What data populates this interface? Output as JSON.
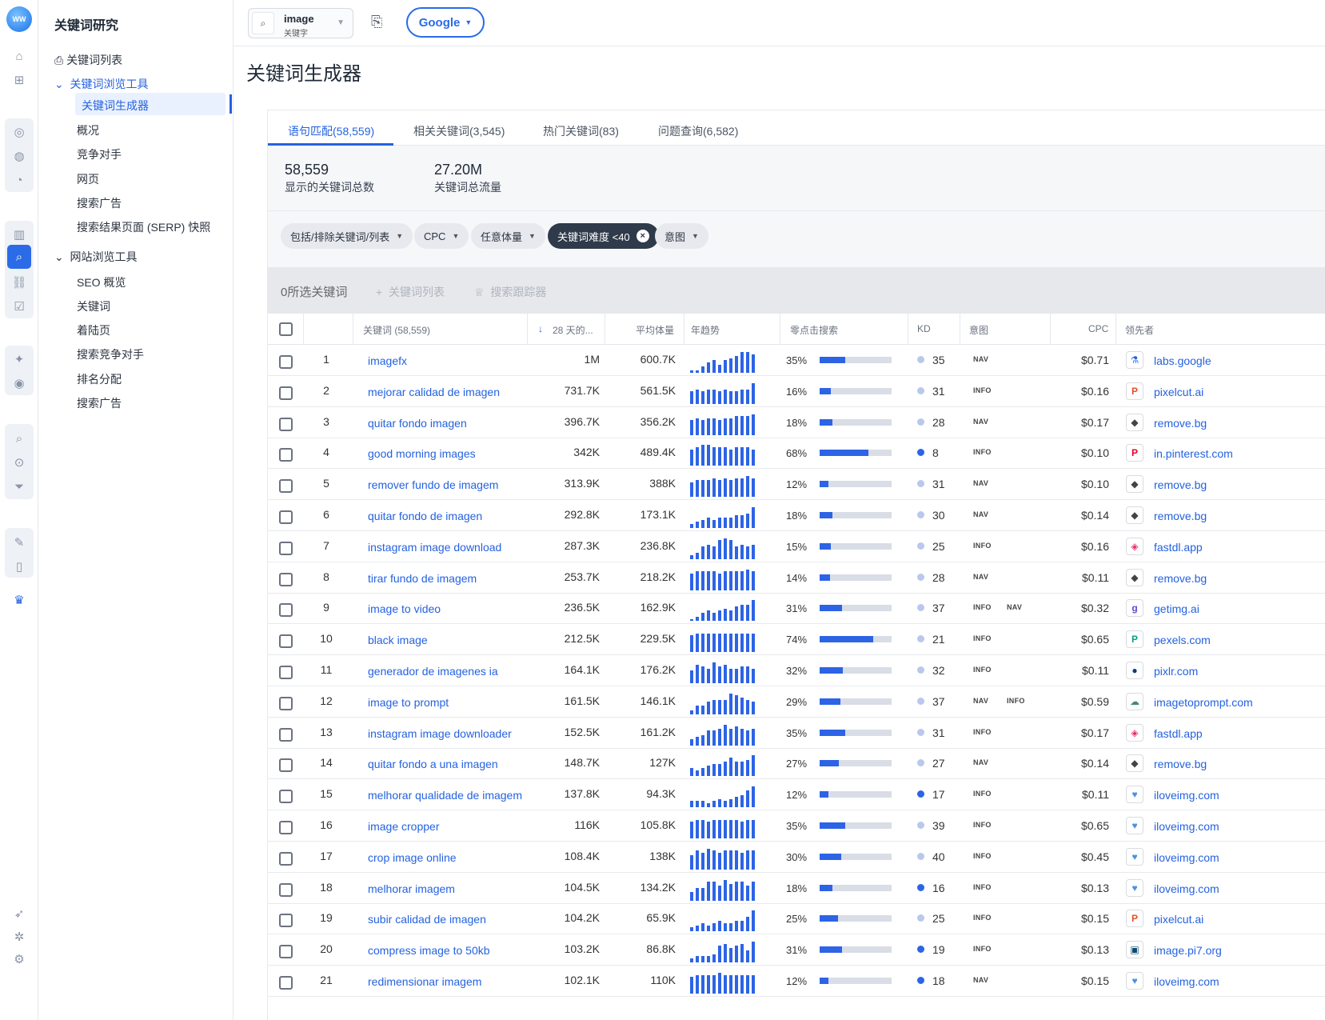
{
  "rail": {
    "logo": "WW",
    "icons": [
      "home-icon",
      "apps-icon",
      "globe-icon",
      "globe-2-icon",
      "pie-icon",
      "bar-chart-icon",
      "keyword-research-icon",
      "link-icon",
      "check-list-icon",
      "sparkle-icon",
      "eye-sparkle-icon",
      "search-zoom-icon",
      "search-target-icon",
      "filter-icon",
      "doc-check-icon",
      "phone-icon",
      "crown-icon",
      "rocket-icon",
      "puzzle-icon",
      "settings-icon"
    ]
  },
  "nav": {
    "title": "关键词研究",
    "keyword_list": "关键词列表",
    "explorer": "关键词浏览工具",
    "items1": [
      "关键词生成器",
      "概况",
      "竞争对手",
      "网页",
      "搜索广告",
      "搜索结果页面 (SERP) 快照"
    ],
    "site_explorer": "网站浏览工具",
    "items2": [
      "SEO 概览",
      "关键词",
      "着陆页",
      "搜索竞争对手",
      "排名分配",
      "搜索广告"
    ]
  },
  "top": {
    "search_value": "image",
    "search_sub": "关键字",
    "engine": "Google"
  },
  "page_title": "关键词生成器",
  "tabs": [
    "语句匹配(58,559)",
    "相关关键词(3,545)",
    "热门关键词(83)",
    "问题查询(6,582)"
  ],
  "stats": [
    {
      "value": "58,559",
      "label": "显示的关键词总数"
    },
    {
      "value": "27.20M",
      "label": "关键词总流量"
    }
  ],
  "filters": [
    "包括/排除关键词/列表",
    "CPC",
    "任意体量",
    "关键词难度 <40",
    "意图"
  ],
  "selection": {
    "count": "0所选关键词",
    "add_list": "关键词列表",
    "tracker": "搜索跟踪器"
  },
  "columns": [
    "关键词 (58,559)",
    "28 天的...",
    "平均体量",
    "年趋势",
    "零点击搜索",
    "KD",
    "意图",
    "CPC",
    "领先者"
  ],
  "colors": {
    "accent": "#2462e0",
    "bar": "#2d64e6",
    "kd_easy": "#b9c8ec",
    "kd_medium": "#2d64e6"
  },
  "rows": [
    {
      "n": "1",
      "kw": "imagefx",
      "v28": "1M",
      "avg": "600.7K",
      "trend": [
        1,
        1,
        3,
        5,
        6,
        4,
        6,
        7,
        8,
        10,
        10,
        9
      ],
      "zp": "35%",
      "zpv": 35,
      "kd": "35",
      "kdc": "easy",
      "intent": [
        "NAV"
      ],
      "cpc": "$0.71",
      "fav": "⚗",
      "favc": "#2462e0",
      "dom": "labs.google"
    },
    {
      "n": "2",
      "kw": "mejorar calidad de imagen",
      "v28": "731.7K",
      "avg": "561.5K",
      "trend": [
        6,
        7,
        6,
        7,
        7,
        6,
        7,
        6,
        6,
        7,
        7,
        10
      ],
      "zp": "16%",
      "zpv": 16,
      "kd": "31",
      "kdc": "easy",
      "intent": [
        "INFO"
      ],
      "cpc": "$0.16",
      "fav": "P",
      "favc": "#e2502a",
      "dom": "pixelcut.ai"
    },
    {
      "n": "3",
      "kw": "quitar fondo imagen",
      "v28": "396.7K",
      "avg": "356.2K",
      "trend": [
        7,
        8,
        7,
        8,
        8,
        7,
        8,
        8,
        9,
        9,
        9,
        10
      ],
      "zp": "18%",
      "zpv": 18,
      "kd": "28",
      "kdc": "easy",
      "intent": [
        "NAV"
      ],
      "cpc": "$0.17",
      "fav": "◆",
      "favc": "#444",
      "dom": "remove.bg"
    },
    {
      "n": "4",
      "kw": "good morning images",
      "v28": "342K",
      "avg": "489.4K",
      "trend": [
        8,
        9,
        10,
        10,
        9,
        9,
        9,
        8,
        9,
        9,
        9,
        8
      ],
      "zp": "68%",
      "zpv": 68,
      "kd": "8",
      "kdc": "medium",
      "intent": [
        "INFO"
      ],
      "cpc": "$0.10",
      "fav": "P",
      "favc": "#e60023",
      "dom": "in.pinterest.com"
    },
    {
      "n": "5",
      "kw": "remover fundo de imagem",
      "v28": "313.9K",
      "avg": "388K",
      "trend": [
        7,
        8,
        8,
        8,
        9,
        8,
        9,
        8,
        9,
        9,
        10,
        9
      ],
      "zp": "12%",
      "zpv": 12,
      "kd": "31",
      "kdc": "easy",
      "intent": [
        "NAV"
      ],
      "cpc": "$0.10",
      "fav": "◆",
      "favc": "#444",
      "dom": "remove.bg"
    },
    {
      "n": "6",
      "kw": "quitar fondo de imagen",
      "v28": "292.8K",
      "avg": "173.1K",
      "trend": [
        2,
        3,
        4,
        5,
        4,
        5,
        5,
        5,
        6,
        6,
        7,
        10
      ],
      "zp": "18%",
      "zpv": 18,
      "kd": "30",
      "kdc": "easy",
      "intent": [
        "NAV"
      ],
      "cpc": "$0.14",
      "fav": "◆",
      "favc": "#444",
      "dom": "remove.bg"
    },
    {
      "n": "7",
      "kw": "instagram image download",
      "v28": "287.3K",
      "avg": "236.8K",
      "trend": [
        2,
        3,
        6,
        7,
        6,
        9,
        10,
        9,
        6,
        7,
        6,
        7
      ],
      "zp": "15%",
      "zpv": 15,
      "kd": "25",
      "kdc": "easy",
      "intent": [
        "INFO"
      ],
      "cpc": "$0.16",
      "fav": "◈",
      "favc": "#e1306c",
      "dom": "fastdl.app"
    },
    {
      "n": "8",
      "kw": "tirar fundo de imagem",
      "v28": "253.7K",
      "avg": "218.2K",
      "trend": [
        8,
        9,
        9,
        9,
        9,
        8,
        9,
        9,
        9,
        9,
        10,
        9
      ],
      "zp": "14%",
      "zpv": 14,
      "kd": "28",
      "kdc": "easy",
      "intent": [
        "NAV"
      ],
      "cpc": "$0.11",
      "fav": "◆",
      "favc": "#444",
      "dom": "remove.bg"
    },
    {
      "n": "9",
      "kw": "image to video",
      "v28": "236.5K",
      "avg": "162.9K",
      "trend": [
        1,
        2,
        4,
        5,
        4,
        5,
        6,
        5,
        7,
        8,
        8,
        10
      ],
      "zp": "31%",
      "zpv": 31,
      "kd": "37",
      "kdc": "easy",
      "intent": [
        "INFO",
        "NAV"
      ],
      "cpc": "$0.32",
      "fav": "g",
      "favc": "#5a4bd6",
      "dom": "getimg.ai"
    },
    {
      "n": "10",
      "kw": "black image",
      "v28": "212.5K",
      "avg": "229.5K",
      "trend": [
        8,
        9,
        9,
        9,
        9,
        9,
        9,
        9,
        9,
        9,
        9,
        9
      ],
      "zp": "74%",
      "zpv": 74,
      "kd": "21",
      "kdc": "easy",
      "intent": [
        "INFO"
      ],
      "cpc": "$0.65",
      "fav": "P",
      "favc": "#05a081",
      "dom": "pexels.com"
    },
    {
      "n": "11",
      "kw": "generador de imagenes ia",
      "v28": "164.1K",
      "avg": "176.2K",
      "trend": [
        6,
        9,
        8,
        7,
        10,
        8,
        9,
        7,
        7,
        8,
        8,
        7
      ],
      "zp": "32%",
      "zpv": 32,
      "kd": "32",
      "kdc": "easy",
      "intent": [
        "INFO"
      ],
      "cpc": "$0.11",
      "fav": "●",
      "favc": "#0a3d7a",
      "dom": "pixlr.com"
    },
    {
      "n": "12",
      "kw": "image to prompt",
      "v28": "161.5K",
      "avg": "146.1K",
      "trend": [
        2,
        4,
        4,
        6,
        7,
        7,
        7,
        10,
        9,
        8,
        7,
        6
      ],
      "zp": "29%",
      "zpv": 29,
      "kd": "37",
      "kdc": "easy",
      "intent": [
        "NAV",
        "INFO"
      ],
      "cpc": "$0.59",
      "fav": "☁",
      "favc": "#3f8b6e",
      "dom": "imagetoprompt.com"
    },
    {
      "n": "13",
      "kw": "instagram image downloader",
      "v28": "152.5K",
      "avg": "161.2K",
      "trend": [
        3,
        4,
        5,
        7,
        7,
        8,
        10,
        8,
        9,
        8,
        7,
        8
      ],
      "zp": "35%",
      "zpv": 35,
      "kd": "31",
      "kdc": "easy",
      "intent": [
        "INFO"
      ],
      "cpc": "$0.17",
      "fav": "◈",
      "favc": "#e1306c",
      "dom": "fastdl.app"
    },
    {
      "n": "14",
      "kw": "quitar fondo a una imagen",
      "v28": "148.7K",
      "avg": "127K",
      "trend": [
        4,
        3,
        4,
        5,
        6,
        6,
        7,
        9,
        7,
        7,
        8,
        10
      ],
      "zp": "27%",
      "zpv": 27,
      "kd": "27",
      "kdc": "easy",
      "intent": [
        "NAV"
      ],
      "cpc": "$0.14",
      "fav": "◆",
      "favc": "#444",
      "dom": "remove.bg"
    },
    {
      "n": "15",
      "kw": "melhorar qualidade de imagem",
      "v28": "137.8K",
      "avg": "94.3K",
      "trend": [
        3,
        3,
        3,
        2,
        3,
        4,
        3,
        4,
        5,
        6,
        8,
        10
      ],
      "zp": "12%",
      "zpv": 12,
      "kd": "17",
      "kdc": "medium",
      "intent": [
        "INFO"
      ],
      "cpc": "$0.11",
      "fav": "♥",
      "favc": "#4a90e2",
      "dom": "iloveimg.com"
    },
    {
      "n": "16",
      "kw": "image cropper",
      "v28": "116K",
      "avg": "105.8K",
      "trend": [
        8,
        9,
        9,
        8,
        9,
        9,
        9,
        9,
        9,
        8,
        9,
        9
      ],
      "zp": "35%",
      "zpv": 35,
      "kd": "39",
      "kdc": "easy",
      "intent": [
        "INFO"
      ],
      "cpc": "$0.65",
      "fav": "♥",
      "favc": "#4a90e2",
      "dom": "iloveimg.com"
    },
    {
      "n": "17",
      "kw": "crop image online",
      "v28": "108.4K",
      "avg": "138K",
      "trend": [
        7,
        9,
        8,
        10,
        9,
        8,
        9,
        9,
        9,
        8,
        9,
        9
      ],
      "zp": "30%",
      "zpv": 30,
      "kd": "40",
      "kdc": "easy",
      "intent": [
        "INFO"
      ],
      "cpc": "$0.45",
      "fav": "♥",
      "favc": "#4a90e2",
      "dom": "iloveimg.com"
    },
    {
      "n": "18",
      "kw": "melhorar imagem",
      "v28": "104.5K",
      "avg": "134.2K",
      "trend": [
        4,
        6,
        6,
        9,
        9,
        7,
        10,
        8,
        9,
        9,
        7,
        9
      ],
      "zp": "18%",
      "zpv": 18,
      "kd": "16",
      "kdc": "medium",
      "intent": [
        "INFO"
      ],
      "cpc": "$0.13",
      "fav": "♥",
      "favc": "#4a90e2",
      "dom": "iloveimg.com"
    },
    {
      "n": "19",
      "kw": "subir calidad de imagen",
      "v28": "104.2K",
      "avg": "65.9K",
      "trend": [
        2,
        3,
        4,
        3,
        4,
        5,
        4,
        4,
        5,
        5,
        7,
        10
      ],
      "zp": "25%",
      "zpv": 25,
      "kd": "25",
      "kdc": "easy",
      "intent": [
        "INFO"
      ],
      "cpc": "$0.15",
      "fav": "P",
      "favc": "#e2502a",
      "dom": "pixelcut.ai"
    },
    {
      "n": "20",
      "kw": "compress image to 50kb",
      "v28": "103.2K",
      "avg": "86.8K",
      "trend": [
        2,
        3,
        3,
        3,
        4,
        8,
        9,
        7,
        8,
        9,
        6,
        10
      ],
      "zp": "31%",
      "zpv": 31,
      "kd": "19",
      "kdc": "medium",
      "intent": [
        "INFO"
      ],
      "cpc": "$0.13",
      "fav": "▣",
      "favc": "#0b4a6e",
      "dom": "image.pi7.org"
    },
    {
      "n": "21",
      "kw": "redimensionar imagem",
      "v28": "102.1K",
      "avg": "110K",
      "trend": [
        8,
        9,
        9,
        9,
        9,
        10,
        9,
        9,
        9,
        9,
        9,
        9
      ],
      "zp": "12%",
      "zpv": 12,
      "kd": "18",
      "kdc": "medium",
      "intent": [
        "NAV"
      ],
      "cpc": "$0.15",
      "fav": "♥",
      "favc": "#4a90e2",
      "dom": "iloveimg.com"
    }
  ]
}
